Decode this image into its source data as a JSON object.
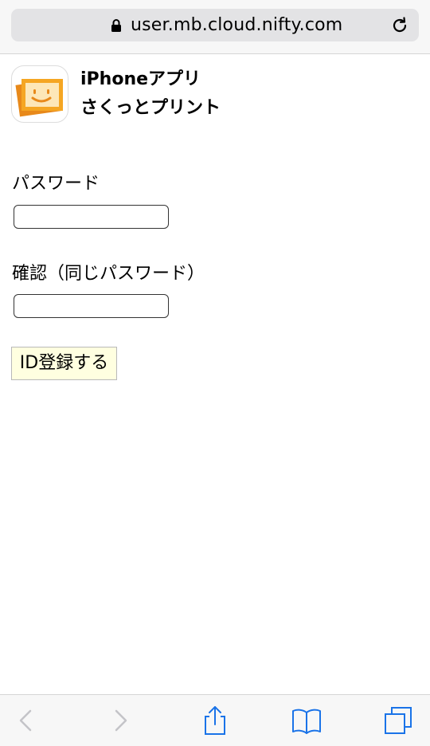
{
  "browser": {
    "url": "user.mb.cloud.nifty.com",
    "accent_color": "#1a73e8",
    "disabled_color": "#c4c4c8",
    "icons": {
      "lock": "lock-icon",
      "reload": "reload-icon",
      "back": "back-icon",
      "forward": "forward-icon",
      "share": "share-icon",
      "bookmarks": "bookmarks-icon",
      "tabs": "tabs-icon"
    }
  },
  "app": {
    "name_line1": "iPhoneアプリ",
    "name_line2": "さくっとプリント",
    "icon": "smiley-photo-icon",
    "icon_colors": [
      "#f5a623",
      "#e8891a",
      "#fde7b8"
    ]
  },
  "form": {
    "password_label": "パスワード",
    "password_value": "",
    "confirm_label": "確認（同じパスワード）",
    "confirm_value": "",
    "submit_label": "ID登録する",
    "submit_bg": "#ffffe0"
  }
}
